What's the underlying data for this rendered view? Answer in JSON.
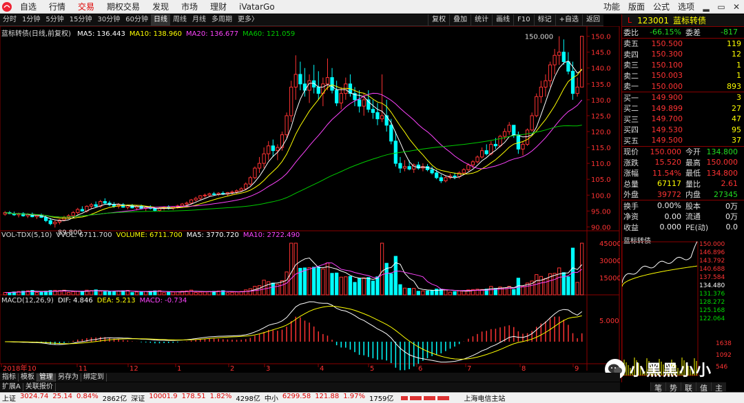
{
  "menubar": {
    "items": [
      "自选",
      "行情",
      "交易",
      "期权交易",
      "发现",
      "市场",
      "理财",
      "iVatarGo"
    ],
    "active_index": 2,
    "right_items": [
      "功能",
      "版面",
      "公式",
      "选项"
    ],
    "window_buttons": [
      "▂",
      "▭",
      "✕"
    ]
  },
  "periodbar": {
    "periods": [
      "分时",
      "1分钟",
      "5分钟",
      "15分钟",
      "30分钟",
      "60分钟",
      "日线",
      "周线",
      "月线",
      "多周期",
      "更多〉"
    ],
    "active_index": 6,
    "tools": [
      "复权",
      "叠加",
      "统计",
      "画线",
      "F10",
      "标记",
      "+自选",
      "返回"
    ]
  },
  "main_chart": {
    "title": "蓝标转债(日线,前复权)",
    "ma": [
      {
        "label": "MA5: 136.443",
        "color": "#ffffff"
      },
      {
        "label": "MA10: 138.960",
        "color": "#ffff00"
      },
      {
        "label": "MA20: 136.677",
        "color": "#ff44ff"
      },
      {
        "label": "MA60: 121.059",
        "color": "#00cc00"
      }
    ],
    "y_ticks": [
      "150.0",
      "145.0",
      "140.0",
      "135.0",
      "130.0",
      "125.0",
      "120.0",
      "115.0",
      "110.0",
      "105.0",
      "100.0",
      "95.00",
      "90.00"
    ],
    "high_label": "150.000",
    "low_label": "89.800"
  },
  "vol_chart": {
    "legend": [
      {
        "label": "VOL-TDX(5,10)",
        "color": "#dddddd"
      },
      {
        "label": "VVOL: 6711.700",
        "color": "#dddddd"
      },
      {
        "label": "VOLUME: 6711.700",
        "color": "#ffff00"
      },
      {
        "label": "MA5: 3770.720",
        "color": "#ffffff"
      },
      {
        "label": "MA10: 2722.490",
        "color": "#ff44ff"
      }
    ],
    "y_ticks": [
      "45000",
      "30000",
      "15000"
    ]
  },
  "macd_chart": {
    "legend": [
      {
        "label": "MACD(12,26,9)",
        "color": "#dddddd"
      },
      {
        "label": "DIF: 4.846",
        "color": "#ffffff"
      },
      {
        "label": "DEA: 5.213",
        "color": "#ffff00"
      },
      {
        "label": "MACD: -0.734",
        "color": "#ff44ff"
      }
    ],
    "y_ticks": [
      "5.000"
    ]
  },
  "x_axis": [
    "2018年",
    "10",
    "11",
    "12",
    "1",
    "2",
    "3",
    "4",
    "5",
    "6",
    "7",
    "8",
    "9"
  ],
  "bottom_tabs": [
    "指标",
    "模板",
    "管理",
    "另存为",
    "绑定到"
  ],
  "bottom_tabs_active": 2,
  "bottom_tabs2": [
    "扩展A",
    "关联报价"
  ],
  "right_panel": {
    "market": "L",
    "code": "123001",
    "name": "蓝标转债",
    "ratio": {
      "label": "委比",
      "value": "-66.15%",
      "label2": "委差",
      "value2": "-817"
    },
    "asks": [
      {
        "label": "卖五",
        "price": "150.500",
        "vol": "119"
      },
      {
        "label": "卖四",
        "price": "150.300",
        "vol": "12"
      },
      {
        "label": "卖三",
        "price": "150.100",
        "vol": "1"
      },
      {
        "label": "卖二",
        "price": "150.003",
        "vol": "1"
      },
      {
        "label": "卖一",
        "price": "150.000",
        "vol": "893"
      }
    ],
    "bids": [
      {
        "label": "买一",
        "price": "149.900",
        "vol": "3"
      },
      {
        "label": "买二",
        "price": "149.899",
        "vol": "27"
      },
      {
        "label": "买三",
        "price": "149.700",
        "vol": "47"
      },
      {
        "label": "买四",
        "price": "149.530",
        "vol": "95"
      },
      {
        "label": "买五",
        "price": "149.500",
        "vol": "37"
      }
    ],
    "stats": [
      {
        "l1": "现价",
        "v1": "150.000",
        "c1": "red",
        "l2": "今开",
        "v2": "134.800",
        "c2": "green"
      },
      {
        "l1": "涨跌",
        "v1": "15.520",
        "c1": "red",
        "l2": "最高",
        "v2": "150.000",
        "c2": "red"
      },
      {
        "l1": "涨幅",
        "v1": "11.54%",
        "c1": "red",
        "l2": "最低",
        "v2": "134.800",
        "c2": "red"
      },
      {
        "l1": "总量",
        "v1": "67117",
        "c1": "yellow",
        "l2": "量比",
        "v2": "2.61",
        "c2": "red"
      },
      {
        "l1": "外盘",
        "v1": "39772",
        "c1": "red",
        "l2": "内盘",
        "v2": "27345",
        "c2": "green"
      }
    ],
    "stats2": [
      {
        "l1": "换手",
        "v1": "0.00%",
        "l2": "股本",
        "v2": "0万"
      },
      {
        "l1": "净资",
        "v1": "0.00",
        "l2": "流通",
        "v2": "0万"
      },
      {
        "l1": "收益",
        "v1": "0.000",
        "l2": "PE(动)",
        "v2": "0.0"
      }
    ]
  },
  "mini_chart": {
    "title": "蓝标转债",
    "y_ticks": [
      {
        "v": "150.000",
        "c": "#ff3333"
      },
      {
        "v": "146.896",
        "c": "#ff3333"
      },
      {
        "v": "143.792",
        "c": "#ff3333"
      },
      {
        "v": "140.688",
        "c": "#ff3333"
      },
      {
        "v": "137.584",
        "c": "#ff3333"
      },
      {
        "v": "134.480",
        "c": "#ffffff"
      },
      {
        "v": "131.376",
        "c": "#00dd00"
      },
      {
        "v": "128.272",
        "c": "#00dd00"
      },
      {
        "v": "125.168",
        "c": "#00dd00"
      },
      {
        "v": "122.064",
        "c": "#00dd00"
      }
    ],
    "vol_ticks": [
      "1638",
      "1092",
      "546"
    ]
  },
  "side_buttons": [
    "笔",
    "势",
    "联",
    "值",
    "主"
  ],
  "watermark": "小黑黑小小",
  "status": {
    "items": [
      {
        "t": "上证",
        "c": ""
      },
      {
        "t": "3024.74",
        "c": "sr"
      },
      {
        "t": "25.14",
        "c": "sr"
      },
      {
        "t": "0.84%",
        "c": "sr"
      },
      {
        "t": "2862亿",
        "c": ""
      },
      {
        "t": "深证",
        "c": ""
      },
      {
        "t": "10001.9",
        "c": "sr"
      },
      {
        "t": "178.51",
        "c": "sr"
      },
      {
        "t": "1.82%",
        "c": "sr"
      },
      {
        "t": "4298亿",
        "c": ""
      },
      {
        "t": "中小",
        "c": ""
      },
      {
        "t": "6299.58",
        "c": "sr"
      },
      {
        "t": "121.88",
        "c": "sr"
      },
      {
        "t": "1.97%",
        "c": "sr"
      },
      {
        "t": "1759亿",
        "c": ""
      }
    ],
    "server": "上海电信主站"
  },
  "chart_data": {
    "type": "candlestick",
    "candles": [
      [
        94,
        95,
        93.5,
        94.5
      ],
      [
        94.5,
        95,
        94,
        94.2
      ],
      [
        94.2,
        94.8,
        93.5,
        93.8
      ],
      [
        93.8,
        94.5,
        93,
        94.2
      ],
      [
        94.2,
        94.6,
        93.2,
        93.5
      ],
      [
        93.5,
        94.3,
        92.8,
        94
      ],
      [
        94,
        94.5,
        93,
        93.2
      ],
      [
        93.2,
        94,
        92.5,
        93.6
      ],
      [
        93.6,
        94.2,
        92.8,
        93
      ],
      [
        93,
        93.5,
        91.5,
        92
      ],
      [
        92,
        92.8,
        90.5,
        91
      ],
      [
        91,
        92,
        89.8,
        91.5
      ],
      [
        91.5,
        92.5,
        90.8,
        92.2
      ],
      [
        92.2,
        93.5,
        91.8,
        93
      ],
      [
        93,
        94,
        92.5,
        93.5
      ],
      [
        93.5,
        95,
        93,
        94.5
      ],
      [
        94.5,
        96,
        94,
        95.5
      ],
      [
        95.5,
        96.5,
        94.8,
        95
      ],
      [
        95,
        96.8,
        94.5,
        96.5
      ],
      [
        96.5,
        97.5,
        95.8,
        97
      ],
      [
        97,
        98,
        96,
        96.5
      ],
      [
        96.5,
        98.5,
        96,
        98
      ],
      [
        98,
        99,
        97,
        97.5
      ],
      [
        97.5,
        98.2,
        96.5,
        97
      ],
      [
        97,
        97.8,
        96,
        96.5
      ],
      [
        96.5,
        97.5,
        95.8,
        97
      ],
      [
        97,
        97.5,
        96,
        96.2
      ],
      [
        96.2,
        97,
        95.5,
        96.8
      ],
      [
        96.8,
        97.2,
        95.8,
        96
      ],
      [
        96,
        96.8,
        95.2,
        96.5
      ],
      [
        96.5,
        97,
        95.5,
        95.8
      ],
      [
        95.8,
        96.5,
        95,
        96.2
      ],
      [
        96.2,
        96.8,
        95.5,
        95.8
      ],
      [
        95.8,
        96.2,
        94.8,
        95.2
      ],
      [
        95.2,
        96,
        94.8,
        95.8
      ],
      [
        95.8,
        96.5,
        95.2,
        96.2
      ],
      [
        96.2,
        96.8,
        95.5,
        95.9
      ],
      [
        95.9,
        96.5,
        95.3,
        96.3
      ],
      [
        96.3,
        97,
        95.8,
        96.6
      ],
      [
        96.6,
        97.5,
        96.2,
        97.2
      ],
      [
        97.2,
        98,
        96.8,
        97.5
      ],
      [
        97.5,
        98.8,
        97,
        98.5
      ],
      [
        98.5,
        99.5,
        98,
        99
      ],
      [
        99,
        100,
        98.5,
        99.8
      ],
      [
        99.8,
        100.5,
        99.2,
        100
      ],
      [
        100,
        100.8,
        99.5,
        100.4
      ],
      [
        100.4,
        101,
        99.8,
        100.2
      ],
      [
        100.2,
        100.9,
        99.7,
        100.6
      ],
      [
        100.6,
        101.2,
        100,
        100.3
      ],
      [
        100.3,
        101,
        99.8,
        100.8
      ],
      [
        100.8,
        101.5,
        100.2,
        101
      ],
      [
        101,
        101.8,
        100.5,
        101.4
      ],
      [
        101.4,
        102.5,
        101,
        102
      ],
      [
        102,
        104,
        101.5,
        103.5
      ],
      [
        103.5,
        106,
        103,
        105.5
      ],
      [
        105.5,
        109,
        105,
        108.5
      ],
      [
        108.5,
        112,
        107,
        110
      ],
      [
        110,
        115,
        108.5,
        113
      ],
      [
        113,
        117,
        111,
        115.5
      ],
      [
        115.5,
        117.5,
        112,
        114
      ],
      [
        114,
        116,
        111,
        115
      ],
      [
        115,
        120,
        114,
        119
      ],
      [
        119,
        126,
        118,
        125
      ],
      [
        125,
        136,
        123,
        134
      ],
      [
        134,
        144,
        130,
        138
      ],
      [
        138,
        142,
        133,
        135
      ],
      [
        135,
        140,
        131,
        133
      ],
      [
        133,
        138,
        129,
        136
      ],
      [
        136,
        141,
        132,
        134
      ],
      [
        134,
        139,
        130,
        132
      ],
      [
        132,
        137,
        128,
        135
      ],
      [
        135,
        143,
        133,
        137
      ],
      [
        137,
        140,
        132,
        133
      ],
      [
        133,
        136,
        128,
        129
      ],
      [
        129,
        134,
        127,
        132
      ],
      [
        132,
        137,
        130,
        135
      ],
      [
        135,
        138,
        131,
        132
      ],
      [
        132,
        134,
        128,
        130
      ],
      [
        130,
        133,
        126,
        128
      ],
      [
        128,
        132,
        125,
        130
      ],
      [
        130,
        133,
        126,
        127
      ],
      [
        127,
        130,
        124,
        126
      ],
      [
        126,
        129,
        122,
        124
      ],
      [
        124,
        138,
        123,
        125
      ],
      [
        125,
        130,
        120,
        122
      ],
      [
        122,
        124,
        116,
        117
      ],
      [
        117,
        120,
        109,
        110
      ],
      [
        110,
        112,
        107,
        108.5
      ],
      [
        108.5,
        111,
        107.5,
        109
      ],
      [
        109,
        111,
        107.8,
        108.2
      ],
      [
        108.2,
        110,
        107,
        109.5
      ],
      [
        109.5,
        110.5,
        108,
        108.5
      ],
      [
        108.5,
        110,
        107.5,
        109
      ],
      [
        109,
        109.8,
        107.5,
        108
      ],
      [
        108,
        109,
        106.5,
        107
      ],
      [
        107,
        108,
        105,
        105.5
      ],
      [
        105.5,
        106.5,
        103.8,
        104.5
      ],
      [
        104.5,
        106,
        104,
        105.5
      ],
      [
        105.5,
        106.8,
        105,
        106
      ],
      [
        106,
        107,
        105,
        105.8
      ],
      [
        105.8,
        107.5,
        105.2,
        107
      ],
      [
        107,
        108.5,
        106.5,
        108
      ],
      [
        108,
        110,
        107.5,
        109.5
      ],
      [
        109.5,
        111,
        108.5,
        110.5
      ],
      [
        110.5,
        112.5,
        110,
        112
      ],
      [
        112,
        115,
        111.5,
        114
      ],
      [
        114,
        116,
        112.5,
        113
      ],
      [
        113,
        117,
        112.5,
        116
      ],
      [
        116,
        118,
        114.5,
        115.5
      ],
      [
        115.5,
        119,
        115,
        118.5
      ],
      [
        118.5,
        121,
        117.5,
        120
      ],
      [
        120,
        123,
        119,
        122
      ],
      [
        122,
        121.5,
        118,
        119
      ],
      [
        119,
        120,
        113,
        114.5
      ],
      [
        114.5,
        117,
        112.5,
        116
      ],
      [
        116,
        121,
        115.5,
        120.5
      ],
      [
        120.5,
        126,
        120,
        125
      ],
      [
        125,
        132,
        124.5,
        131
      ],
      [
        131,
        136,
        129,
        134
      ],
      [
        134,
        138,
        131,
        136
      ],
      [
        136,
        142,
        134,
        141
      ],
      [
        141,
        146,
        138,
        144
      ],
      [
        144,
        150,
        141,
        145
      ],
      [
        145,
        149,
        141,
        142
      ],
      [
        142,
        145,
        138,
        139
      ],
      [
        139,
        142,
        130,
        132
      ],
      [
        132,
        137,
        131,
        134
      ],
      [
        134,
        150,
        134,
        150
      ]
    ],
    "ylim": [
      89,
      151
    ]
  }
}
